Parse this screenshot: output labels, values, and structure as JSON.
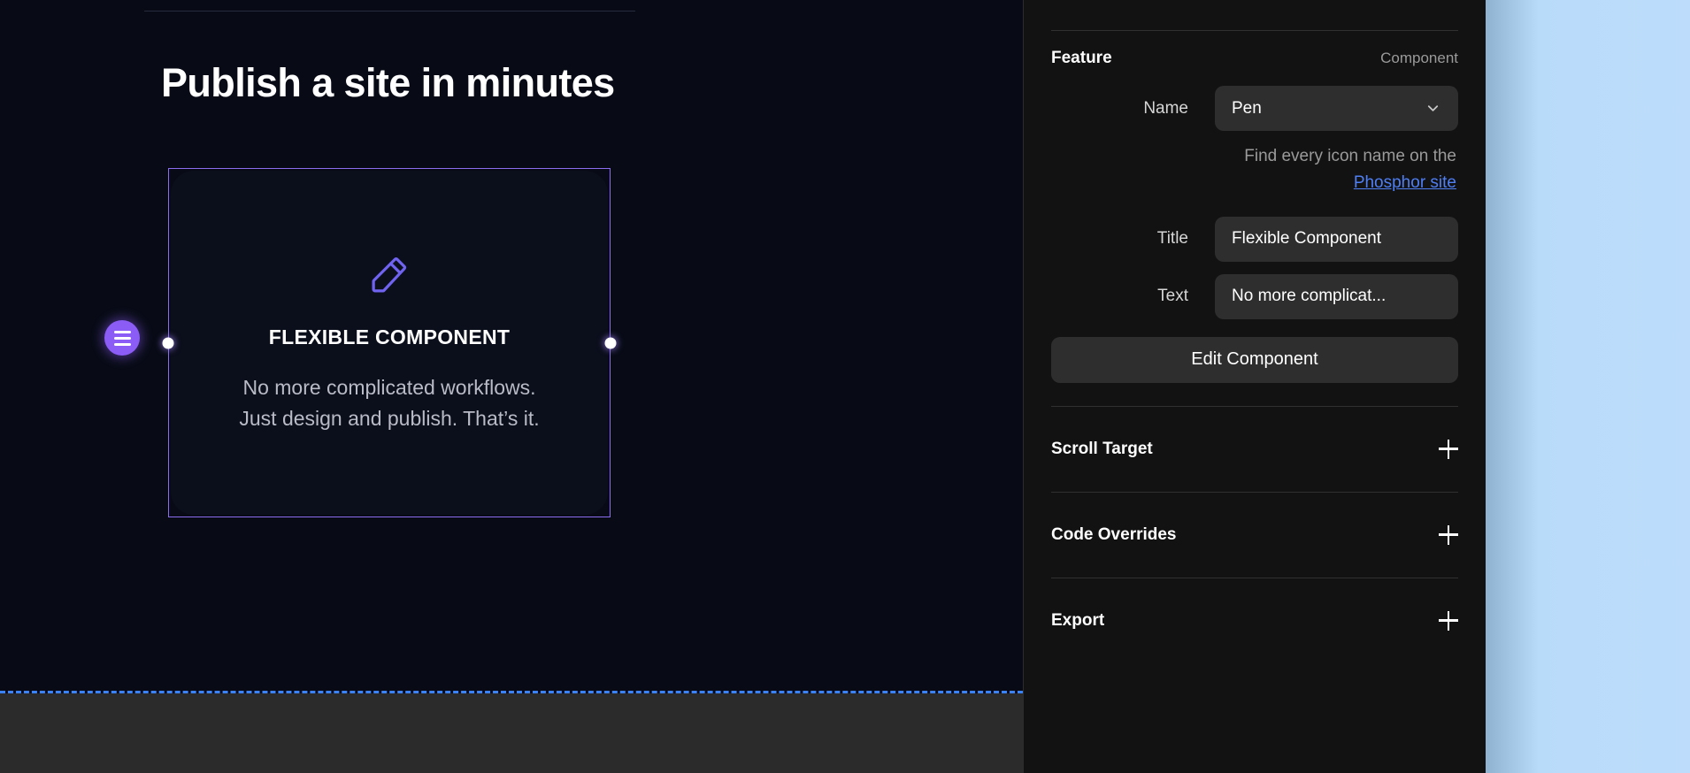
{
  "canvas": {
    "headline": "Publish a site in minutes",
    "card": {
      "icon": "pen-icon",
      "title": "FLEXIBLE COMPONENT",
      "text": "No more complicated workflows. Just design and publish. That’s it.",
      "badge_icon": "layers-icon",
      "selection_color": "#8b6ef0"
    },
    "section_separator_color": "#3b82f6"
  },
  "panel": {
    "section": {
      "title": "Feature",
      "kind": "Component"
    },
    "fields": {
      "name_label": "Name",
      "name_value": "Pen",
      "name_chevron": "chevron-down-icon",
      "help_prefix": "Find every icon name on the ",
      "help_link": "Phosphor site",
      "title_label": "Title",
      "title_value": "Flexible Component",
      "text_label": "Text",
      "text_value": "No more complicat..."
    },
    "edit_button": "Edit Component",
    "collapsibles": [
      {
        "label": "Scroll Target",
        "icon": "plus-icon"
      },
      {
        "label": "Code Overrides",
        "icon": "plus-icon"
      },
      {
        "label": "Export",
        "icon": "plus-icon"
      }
    ],
    "accent_link_color": "#4f7ff5"
  }
}
